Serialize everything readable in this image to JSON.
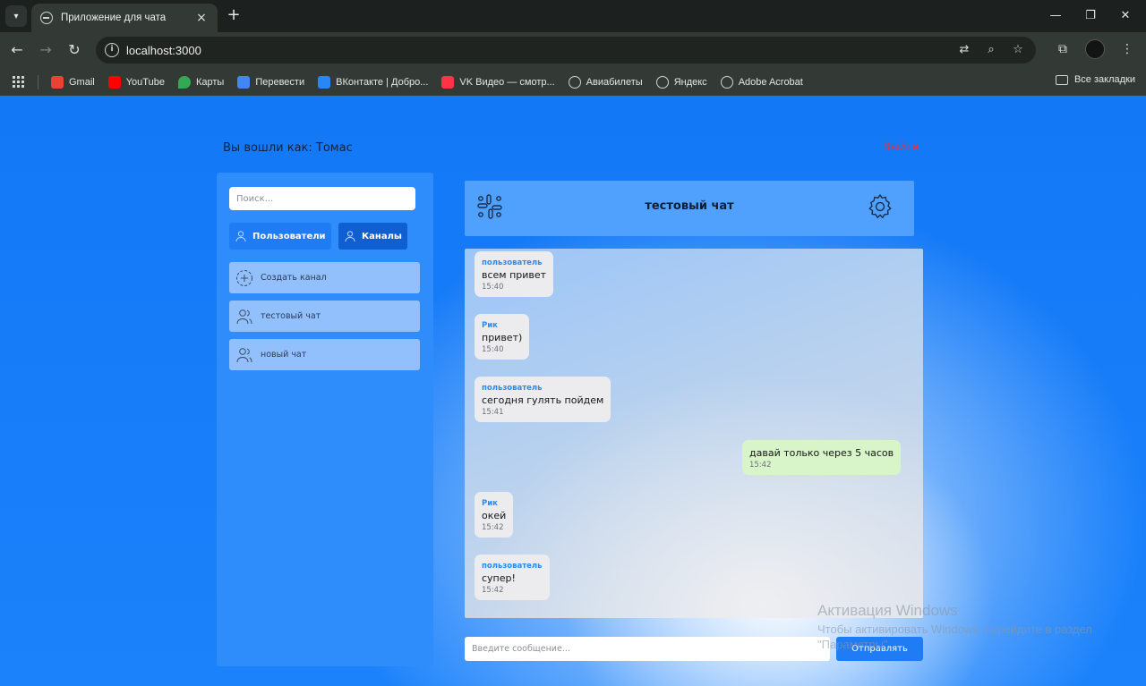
{
  "browser": {
    "tab_title": "Приложение для чата",
    "url": "localhost:3000",
    "bookmarks": [
      {
        "label": "Gmail",
        "icon": "gmail-icon",
        "color": "#ea4335"
      },
      {
        "label": "YouTube",
        "icon": "youtube-icon",
        "color": "#ff0000"
      },
      {
        "label": "Карты",
        "icon": "maps-icon",
        "color": "#34a853"
      },
      {
        "label": "Перевести",
        "icon": "translate-icon",
        "color": "#4285f4"
      },
      {
        "label": "ВКонтакте | Добро...",
        "icon": "vk-icon",
        "color": "#2787f5"
      },
      {
        "label": "VK Видео — смотр...",
        "icon": "vk-video-icon",
        "color": "#ff3347"
      },
      {
        "label": "Авиабилеты",
        "icon": "globe-icon",
        "color": "#d0d3d0"
      },
      {
        "label": "Яндекс",
        "icon": "globe-icon",
        "color": "#d0d3d0"
      },
      {
        "label": "Adobe Acrobat",
        "icon": "globe-icon",
        "color": "#d0d3d0"
      }
    ],
    "all_bookmarks": "Все закладки"
  },
  "header": {
    "logged_in": "Вы вошли как: Томас",
    "logout": "Выйти"
  },
  "sidebar": {
    "search_placeholder": "Поиск...",
    "users_button": "Пользователи",
    "channels_button": "Каналы",
    "create_channel": "Создать канал",
    "channels": [
      "тестовый чат",
      "новый чат"
    ]
  },
  "chat": {
    "title": "тестовый чат",
    "messages": [
      {
        "author": "пользователь",
        "text": "всем привет",
        "time": "15:40",
        "mine": false
      },
      {
        "author": "Рик",
        "text": "привет)",
        "time": "15:40",
        "mine": false
      },
      {
        "author": "пользователь",
        "text": "сегодня гулять пойдем",
        "time": "15:41",
        "mine": false
      },
      {
        "author": "",
        "text": "давай только через 5 часов",
        "time": "15:42",
        "mine": true
      },
      {
        "author": "Рик",
        "text": "окей",
        "time": "15:42",
        "mine": false
      },
      {
        "author": "пользователь",
        "text": "супер!",
        "time": "15:42",
        "mine": false
      }
    ],
    "input_placeholder": "Введите сообщение...",
    "send_button": "Отправлять"
  },
  "watermark": {
    "title": "Активация Windows",
    "line1": "Чтобы активировать Windows, перейдите в раздел",
    "line2": "\"Параметры\"."
  },
  "colors": {
    "page_bg": "#1378f6",
    "accent": "#1f7cf5",
    "logout": "#e0334b",
    "author": "#2a8bf5",
    "own_message": "#d8f5c9"
  }
}
